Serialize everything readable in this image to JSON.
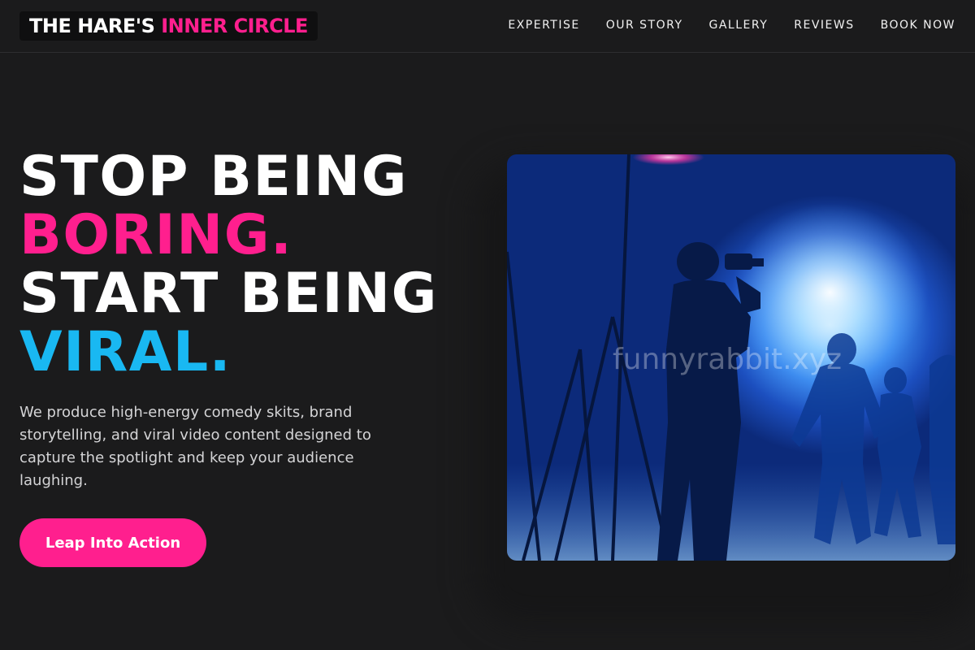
{
  "header": {
    "logo_part1": "THE HARE'S",
    "logo_part2": "INNER CIRCLE",
    "nav": [
      "EXPERTISE",
      "OUR STORY",
      "GALLERY",
      "REVIEWS",
      "BOOK NOW"
    ]
  },
  "hero": {
    "line1": "STOP BEING",
    "line2": "BORING.",
    "line3": "START BEING",
    "line4": "VIRAL.",
    "description": "We produce high-energy comedy skits, brand storytelling, and viral video content designed to capture the spotlight and keep your audience laughing.",
    "cta_label": "Leap Into Action",
    "image_watermark": "funnyrabbit.xyz"
  },
  "colors": {
    "background": "#1b1b1c",
    "accent_pink": "#ff1f8e",
    "accent_blue": "#19b8f2"
  },
  "icons": {
    "hero_image": "film-set-photo"
  }
}
